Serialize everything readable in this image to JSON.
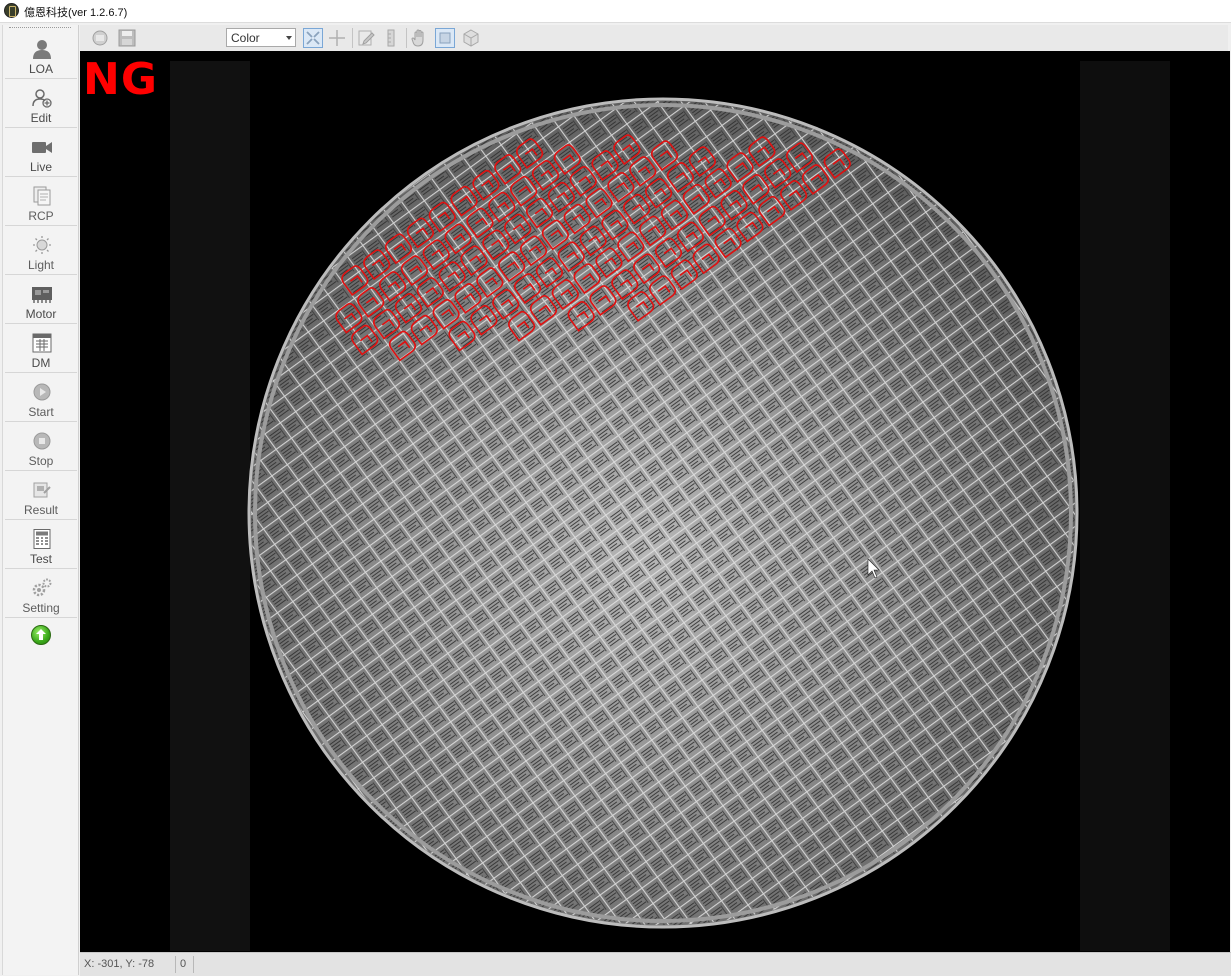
{
  "window": {
    "title": "億恩科技(ver 1.2.6.7)"
  },
  "sidebar": {
    "items": [
      {
        "label": "LOA",
        "icon": "person-icon",
        "enabled": true
      },
      {
        "label": "Edit",
        "icon": "user-edit-icon",
        "enabled": true
      },
      {
        "label": "Live",
        "icon": "video-camera-icon",
        "enabled": true
      },
      {
        "label": "RCP",
        "icon": "recipe-file-icon",
        "enabled": false
      },
      {
        "label": "Light",
        "icon": "light-icon",
        "enabled": false
      },
      {
        "label": "Motor",
        "icon": "motor-board-icon",
        "enabled": true
      },
      {
        "label": "DM",
        "icon": "data-matrix-icon",
        "enabled": true
      },
      {
        "label": "Start",
        "icon": "start-icon",
        "enabled": false
      },
      {
        "label": "Stop",
        "icon": "stop-icon",
        "enabled": false
      },
      {
        "label": "Result",
        "icon": "result-icon",
        "enabled": false
      },
      {
        "label": "Test",
        "icon": "test-calculator-icon",
        "enabled": true
      },
      {
        "label": "Setting",
        "icon": "gear-icon",
        "enabled": false
      }
    ],
    "upload_icon": "upload-arrow-icon"
  },
  "toolbar": {
    "color_mode": "Color",
    "tools": [
      "open-image-icon",
      "save-icon",
      "fit-view-icon",
      "crosshair-icon",
      "edit-pen-icon",
      "ruler-icon",
      "pan-hand-icon",
      "zoom-box-icon",
      "3d-view-icon"
    ]
  },
  "viewer": {
    "result_label": "NG",
    "result_color": "#ff0000",
    "wafer_background": "#000000",
    "defect_color": "#e01010"
  },
  "status": {
    "coordinates": "X: -301, Y: -78",
    "value": "0"
  }
}
